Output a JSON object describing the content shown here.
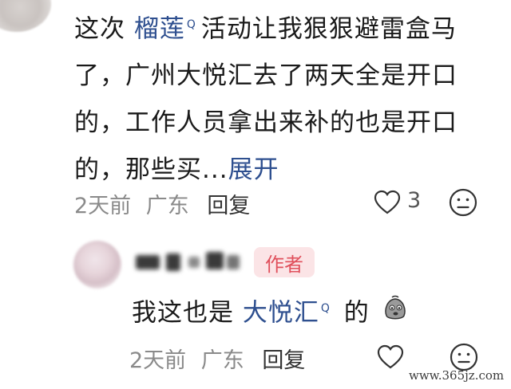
{
  "comment": {
    "text_1": "这次 ",
    "topic": "榴莲",
    "topic_mark": "Q",
    "text_2": "活动让我狠狠避雷盒马了，广州大悦汇去了两天全是开口的，工作人员拿出来补的也是开口的，那些买...",
    "expand_label": "展开",
    "time": "2天前",
    "location": "广东",
    "reply_label": "回复",
    "likes": "3"
  },
  "reply": {
    "author_badge": "作者",
    "text_1": "我这也是 ",
    "topic": "大悦汇",
    "topic_mark": "Q",
    "text_2": " 的",
    "time": "2天前",
    "location": "广东",
    "reply_label": "回复"
  },
  "watermark": "www.365jz.com",
  "icons": {
    "like": "heart-outline-icon",
    "dislike": "neutral-face-icon",
    "emoji": "sad-blob-emoji-icon"
  },
  "colors": {
    "topic_link": "#2e4f8f",
    "badge_bg": "#fbe4e6",
    "badge_text": "#e0505c",
    "meta_text": "#8a8a8a"
  }
}
